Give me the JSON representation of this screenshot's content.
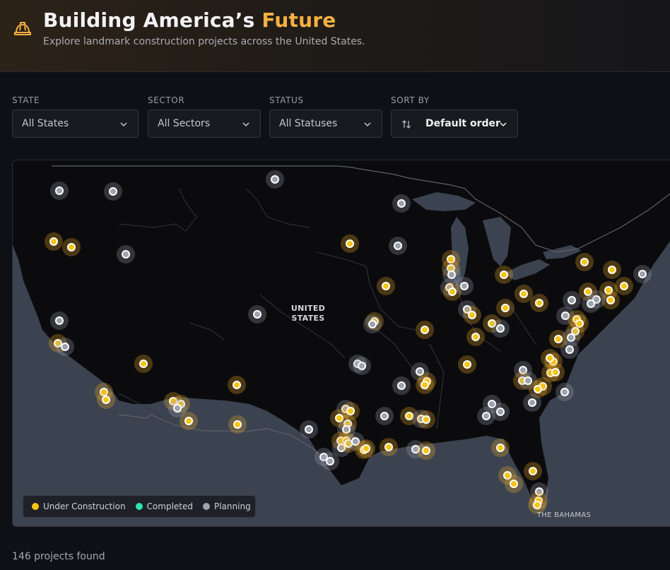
{
  "header": {
    "title_main": "Building America’s ",
    "title_accent": "Future",
    "subtitle": "Explore landmark construction projects across the United States.",
    "icon": "hard-hat-icon",
    "accent_color": "#f5b041"
  },
  "filters": {
    "state": {
      "label": "STATE",
      "value": "All States"
    },
    "sector": {
      "label": "SECTOR",
      "value": "All Sectors"
    },
    "status": {
      "label": "STATUS",
      "value": "All Statuses"
    },
    "sort": {
      "label": "SORT BY",
      "value": "Default order",
      "icon": "sort-arrows-icon"
    }
  },
  "map": {
    "country_label_1": "UNITED",
    "country_label_2": "STATES",
    "bahamas_label": "THE BAHAMAS"
  },
  "legend": {
    "under_construction": {
      "label": "Under Construction",
      "color": "#f5c518"
    },
    "completed": {
      "label": "Completed",
      "color": "#2ee6a8"
    },
    "planning": {
      "label": "Planning",
      "color": "#9ca3af"
    }
  },
  "results": {
    "count_text": "146 projects found"
  }
}
